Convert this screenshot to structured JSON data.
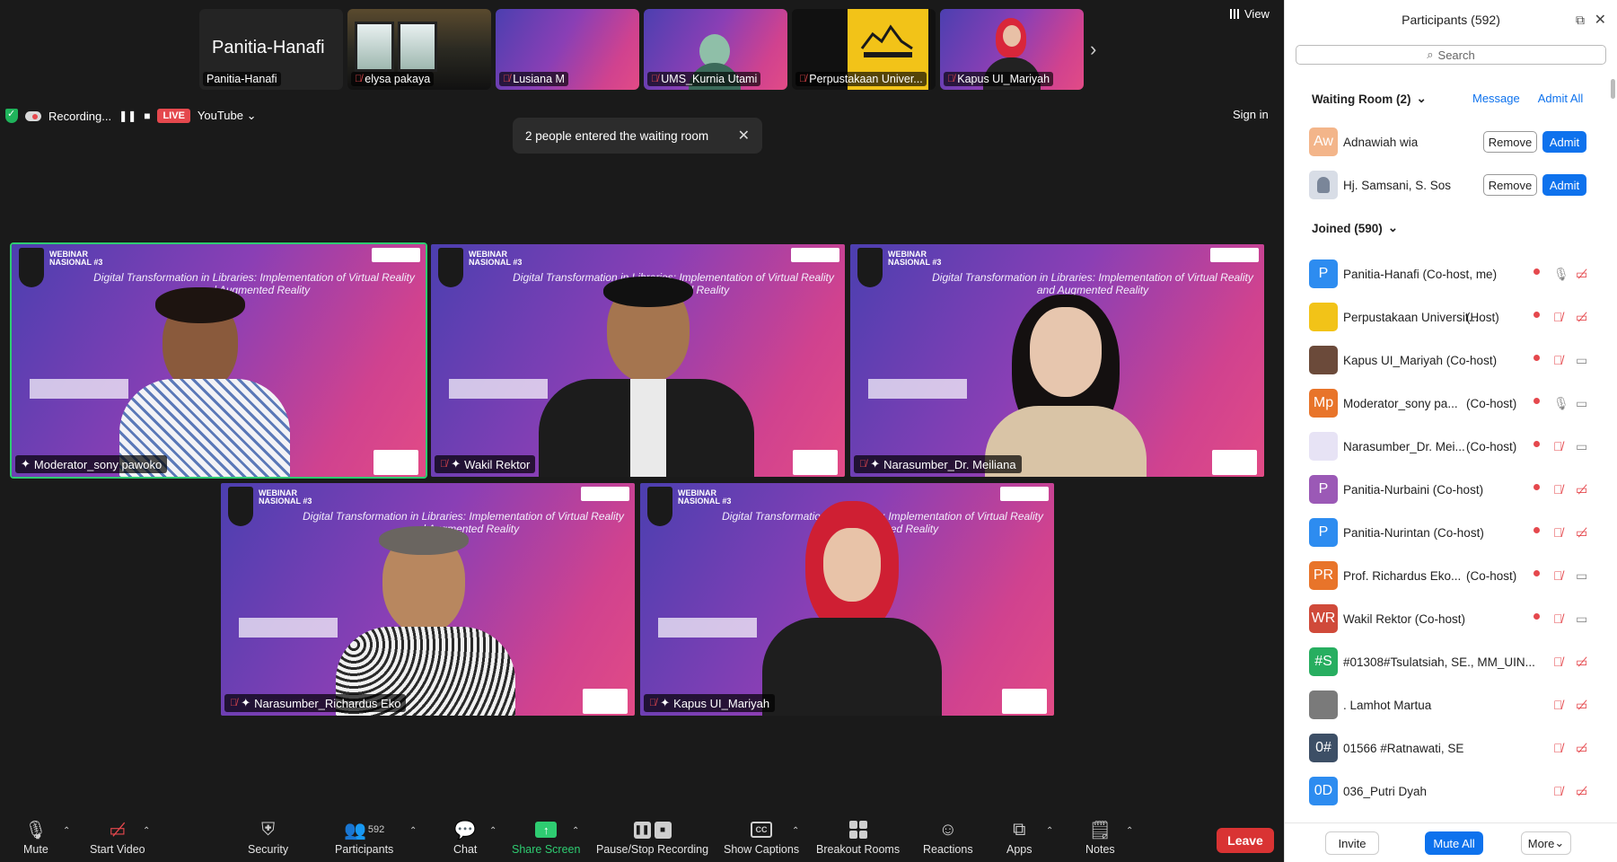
{
  "top_strip": {
    "thumbnails": [
      {
        "label": "Panitia-Hanafi",
        "big_name": "Panitia-Hanafi"
      },
      {
        "label": "elysa pakaya"
      },
      {
        "label": "Lusiana M"
      },
      {
        "label": "UMS_Kurnia Utami"
      },
      {
        "label": "Perpustakaan Univer..."
      },
      {
        "label": "Kapus UI_Mariyah"
      }
    ],
    "view_label": "View"
  },
  "recording_bar": {
    "status": "Recording...",
    "live": "LIVE",
    "platform": "YouTube",
    "sign_in": "Sign in"
  },
  "toast": {
    "message": "2 people entered the waiting room"
  },
  "slide": {
    "title": "Digital Transformation in Libraries: Implementation of Virtual Reality and Augmented Reality",
    "webinar": "WEBINAR",
    "series": "NASIONAL #3"
  },
  "tiles": [
    {
      "name": "Moderator_sony pawoko"
    },
    {
      "name": "Wakil Rektor"
    },
    {
      "name": "Narasumber_Dr. Meiliana"
    },
    {
      "name": "Narasumber_Richardus Eko"
    },
    {
      "name": "Kapus UI_Mariyah"
    }
  ],
  "toolbar": {
    "mute": "Mute",
    "start_video": "Start Video",
    "security": "Security",
    "participants": "Participants",
    "participants_count": "592",
    "chat": "Chat",
    "share_screen": "Share Screen",
    "recording": "Pause/Stop Recording",
    "captions": "Show Captions",
    "breakout": "Breakout Rooms",
    "reactions": "Reactions",
    "apps": "Apps",
    "notes": "Notes",
    "leave": "Leave"
  },
  "panel": {
    "title": "Participants (592)",
    "search_placeholder": "Search",
    "waiting_room": {
      "header": "Waiting Room (2)",
      "message": "Message",
      "admit_all": "Admit All",
      "remove": "Remove",
      "admit": "Admit",
      "people": [
        {
          "initials": "Aw",
          "name": "Adnawiah wia",
          "color": "#f3b58a"
        },
        {
          "initials": "",
          "name": "Hj. Samsani, S. Sos",
          "color": "#d8dde6"
        }
      ]
    },
    "joined": {
      "header": "Joined (590)",
      "people": [
        {
          "initials": "P",
          "name": "Panitia-Hanafi (Co-host, me)",
          "role": "",
          "color": "#2d8cf0",
          "rec": true,
          "mic": "on",
          "cam": "off"
        },
        {
          "initials": "",
          "name": "Perpustakaan Universit...",
          "role": "(Host)",
          "color": "#f2c318",
          "rec": true,
          "mic": "off",
          "cam": "off"
        },
        {
          "initials": "",
          "name": "Kapus UI_Mariyah (Co-host)",
          "role": "",
          "color": "#6b4a3a",
          "rec": true,
          "mic": "off",
          "cam": "on"
        },
        {
          "initials": "Mp",
          "name": "Moderator_sony pa...",
          "role": "(Co-host)",
          "color": "#e8742a",
          "rec": true,
          "mic": "on",
          "cam": "on"
        },
        {
          "initials": "",
          "name": "Narasumber_Dr. Mei...",
          "role": "(Co-host)",
          "color": "#e7e3f5",
          "rec": true,
          "mic": "off",
          "cam": "on"
        },
        {
          "initials": "P",
          "name": "Panitia-Nurbaini (Co-host)",
          "role": "",
          "color": "#9b59b6",
          "rec": true,
          "mic": "off",
          "cam": "off"
        },
        {
          "initials": "P",
          "name": "Panitia-Nurintan (Co-host)",
          "role": "",
          "color": "#2d8cf0",
          "rec": true,
          "mic": "off",
          "cam": "off"
        },
        {
          "initials": "PR",
          "name": "Prof. Richardus Eko...",
          "role": "(Co-host)",
          "color": "#e8742a",
          "rec": true,
          "mic": "off",
          "cam": "on"
        },
        {
          "initials": "WR",
          "name": "Wakil Rektor (Co-host)",
          "role": "",
          "color": "#d04a3a",
          "rec": true,
          "mic": "off",
          "cam": "on"
        },
        {
          "initials": "#S",
          "name": "#01308#Tsulatsiah, SE., MM_UIN...",
          "role": "",
          "color": "#27ae60",
          "rec": false,
          "mic": "off",
          "cam": "off"
        },
        {
          "initials": "",
          "name": ". Lamhot Martua",
          "role": "",
          "color": "#7a7a7a",
          "rec": false,
          "mic": "off",
          "cam": "off"
        },
        {
          "initials": "0#",
          "name": "01566 #Ratnawati, SE",
          "role": "",
          "color": "#3d4f66",
          "rec": false,
          "mic": "off",
          "cam": "off"
        },
        {
          "initials": "0D",
          "name": "036_Putri Dyah",
          "role": "",
          "color": "#2d8cf0",
          "rec": false,
          "mic": "off",
          "cam": "off"
        }
      ]
    },
    "footer": {
      "invite": "Invite",
      "mute_all": "Mute All",
      "more": "More"
    }
  }
}
